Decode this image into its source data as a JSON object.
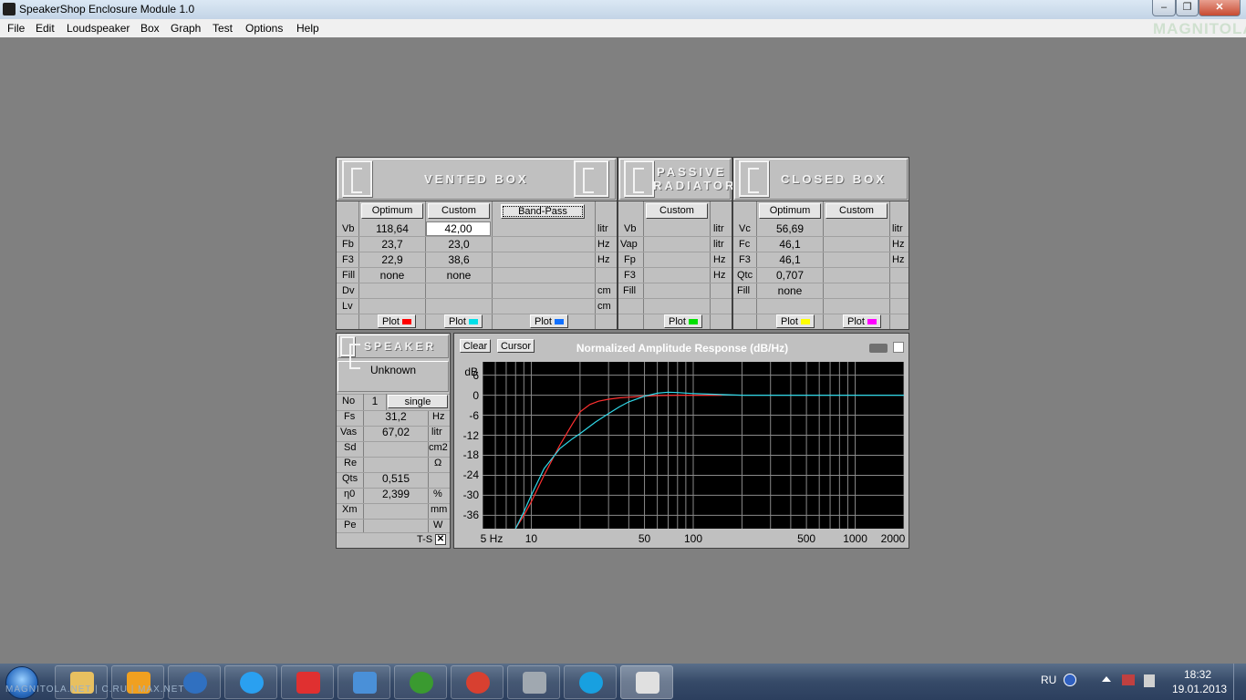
{
  "window": {
    "title": "SpeakerShop Enclosure Module 1.0",
    "min_glyph": "‒",
    "max_glyph": "❐",
    "close_glyph": "✕",
    "watermark": "MAGNITOLA"
  },
  "menu": [
    "File",
    "Edit",
    "Loudspeaker",
    "Box",
    "Graph",
    "Test",
    "Options",
    "Help"
  ],
  "vented_box": {
    "title": "VENTED BOX",
    "col_optimum": "Optimum",
    "col_custom": "Custom",
    "bandpass_button": "Band-Pass",
    "rows": [
      {
        "label": "Vb",
        "optimum": "118,64",
        "custom": "42,00",
        "unit": "litr"
      },
      {
        "label": "Fb",
        "optimum": "23,7",
        "custom": "23,0",
        "unit": "Hz"
      },
      {
        "label": "F3",
        "optimum": "22,9",
        "custom": "38,6",
        "unit": "Hz"
      },
      {
        "label": "Fill",
        "optimum": "none",
        "custom": "none",
        "unit": ""
      },
      {
        "label": "Dv",
        "optimum": "",
        "custom": "",
        "unit": "cm"
      },
      {
        "label": "Lv",
        "optimum": "",
        "custom": "",
        "unit": "cm"
      }
    ],
    "plot_label": "Plot",
    "plot_colors": [
      "#ff0000",
      "#00e0e8",
      "#1070ff"
    ]
  },
  "passive_radiator": {
    "title_line1": "PASSIVE",
    "title_line2": "RADIATOR",
    "col_custom": "Custom",
    "rows": [
      {
        "label": "Vb",
        "unit": "litr"
      },
      {
        "label": "Vap",
        "unit": "litr"
      },
      {
        "label": "Fp",
        "unit": "Hz"
      },
      {
        "label": "F3",
        "unit": "Hz"
      },
      {
        "label": "Fill",
        "unit": ""
      }
    ],
    "plot_label": "Plot",
    "plot_color": "#00e000"
  },
  "closed_box": {
    "title": "CLOSED BOX",
    "col_optimum": "Optimum",
    "col_custom": "Custom",
    "rows": [
      {
        "label": "Vc",
        "optimum": "56,69",
        "unit": "litr"
      },
      {
        "label": "Fc",
        "optimum": "46,1",
        "unit": "Hz"
      },
      {
        "label": "F3",
        "optimum": "46,1",
        "unit": "Hz"
      },
      {
        "label": "Qtc",
        "optimum": "0,707",
        "unit": ""
      },
      {
        "label": "Fill",
        "optimum": "none",
        "unit": ""
      }
    ],
    "plot_label": "Plot",
    "plot_colors": [
      "#ffff00",
      "#ff00ff"
    ]
  },
  "speaker": {
    "title": "SPEAKER",
    "name": "Unknown",
    "no_label": "No",
    "no_value": "1",
    "mode": "single",
    "rows": [
      {
        "label": "Fs",
        "value": "31,2",
        "unit": "Hz"
      },
      {
        "label": "Vas",
        "value": "67,02",
        "unit": "litr"
      },
      {
        "label": "Sd",
        "value": "",
        "unit": "cm2"
      },
      {
        "label": "Re",
        "value": "",
        "unit": "Ω"
      },
      {
        "label": "Qts",
        "value": "0,515",
        "unit": ""
      },
      {
        "label": "η0",
        "value": "2,399",
        "unit": "%"
      },
      {
        "label": "Xm",
        "value": "",
        "unit": "mm"
      },
      {
        "label": "Pe",
        "value": "",
        "unit": "W"
      }
    ],
    "ts_label": "T-S",
    "ts_checked": "✕"
  },
  "graph": {
    "clear_button": "Clear",
    "cursor_button": "Cursor"
  },
  "chart_data": {
    "type": "line",
    "title": "Normalized Amplitude Response (dB/Hz)",
    "ylabel": "dB",
    "xlabel": "",
    "x_scale": "log",
    "xlim": [
      5,
      2000
    ],
    "ylim": [
      -40,
      10
    ],
    "grid": true,
    "y_ticks": [
      "6",
      "0",
      "-6",
      "-12",
      "-18",
      "-24",
      "-30",
      "-36"
    ],
    "x_ticks": [
      {
        "value": 5,
        "label": "5 Hz"
      },
      {
        "value": 10,
        "label": "10"
      },
      {
        "value": 50,
        "label": "50"
      },
      {
        "value": 100,
        "label": "100"
      },
      {
        "value": 500,
        "label": "500"
      },
      {
        "value": 1000,
        "label": "1000"
      },
      {
        "value": 2000,
        "label": "2000"
      }
    ],
    "series": [
      {
        "color": "#ff3030",
        "x": [
          8,
          9,
          10,
          12,
          15,
          18,
          20,
          23,
          26,
          30,
          35,
          40,
          50,
          60,
          80,
          100,
          150
        ],
        "y": [
          -40,
          -36,
          -32,
          -24,
          -15,
          -8.5,
          -5,
          -2.8,
          -1.8,
          -1.2,
          -0.8,
          -0.6,
          -0.3,
          -0.1,
          0,
          0,
          0
        ]
      },
      {
        "color": "#30d8e8",
        "x": [
          8,
          9,
          10,
          12,
          15,
          18,
          20,
          25,
          30,
          35,
          40,
          50,
          60,
          70,
          80,
          100,
          150,
          200,
          300,
          500,
          1000,
          2000
        ],
        "y": [
          -40,
          -35,
          -30,
          -22,
          -16,
          -13,
          -11.5,
          -8,
          -5.5,
          -3.5,
          -2,
          -0.3,
          0.6,
          0.9,
          0.8,
          0.5,
          0.2,
          0,
          0,
          0,
          0,
          0
        ]
      }
    ]
  },
  "taskbar": {
    "language": "RU",
    "time": "18:32",
    "date": "19.01.2013",
    "watermark": "MAGNITOLA.NET | C.RU | MAX.NET"
  }
}
